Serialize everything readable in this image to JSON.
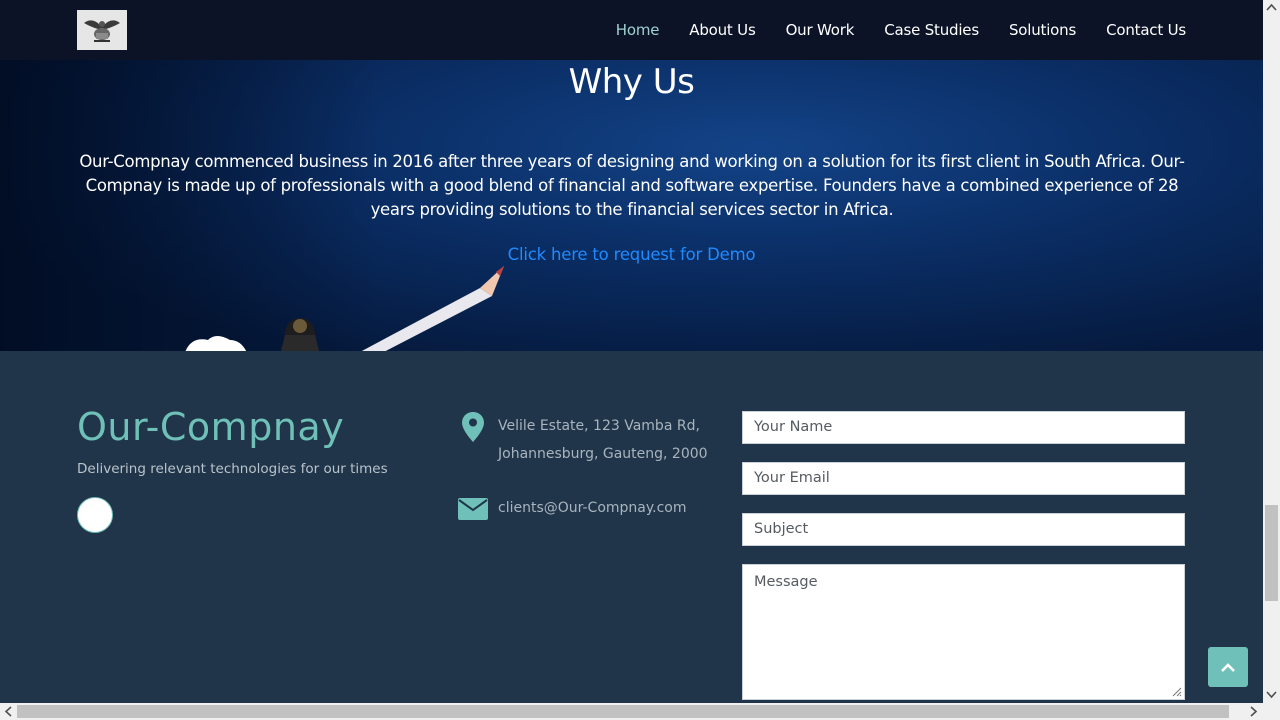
{
  "nav": {
    "logo_icon": "eagle-logo-icon",
    "items": [
      "Home",
      "About Us",
      "Our Work",
      "Case Studies",
      "Solutions",
      "Contact Us"
    ],
    "active_index": 0
  },
  "hero": {
    "title": "Why Us",
    "body": "Our-Compnay commenced business in 2016 after three years of designing and working on a solution for its first client in South Africa. Our-Compnay is made up of professionals with a good blend of financial and software expertise. Founders have a combined experience of 28 years providing solutions to the financial services sector in Africa.",
    "demo_link": "Click here to request for Demo"
  },
  "footer": {
    "brand": "Our-Compnay",
    "tagline": "Delivering relevant technologies for our times",
    "address_line1": "Velile Estate, 123 Vamba Rd,",
    "address_line2": "Johannesburg, Gauteng, 2000",
    "email": "clients@Our-Compnay.com",
    "address_icon": "map-pin-icon",
    "email_icon": "envelope-icon"
  },
  "form": {
    "name_placeholder": "Your Name",
    "email_placeholder": "Your Email",
    "subject_placeholder": "Subject",
    "message_placeholder": "Message"
  },
  "colors": {
    "nav_bg": "#0c1326",
    "footer_bg": "#203549",
    "accent": "#6fc0b8",
    "link": "#1f8bff"
  }
}
